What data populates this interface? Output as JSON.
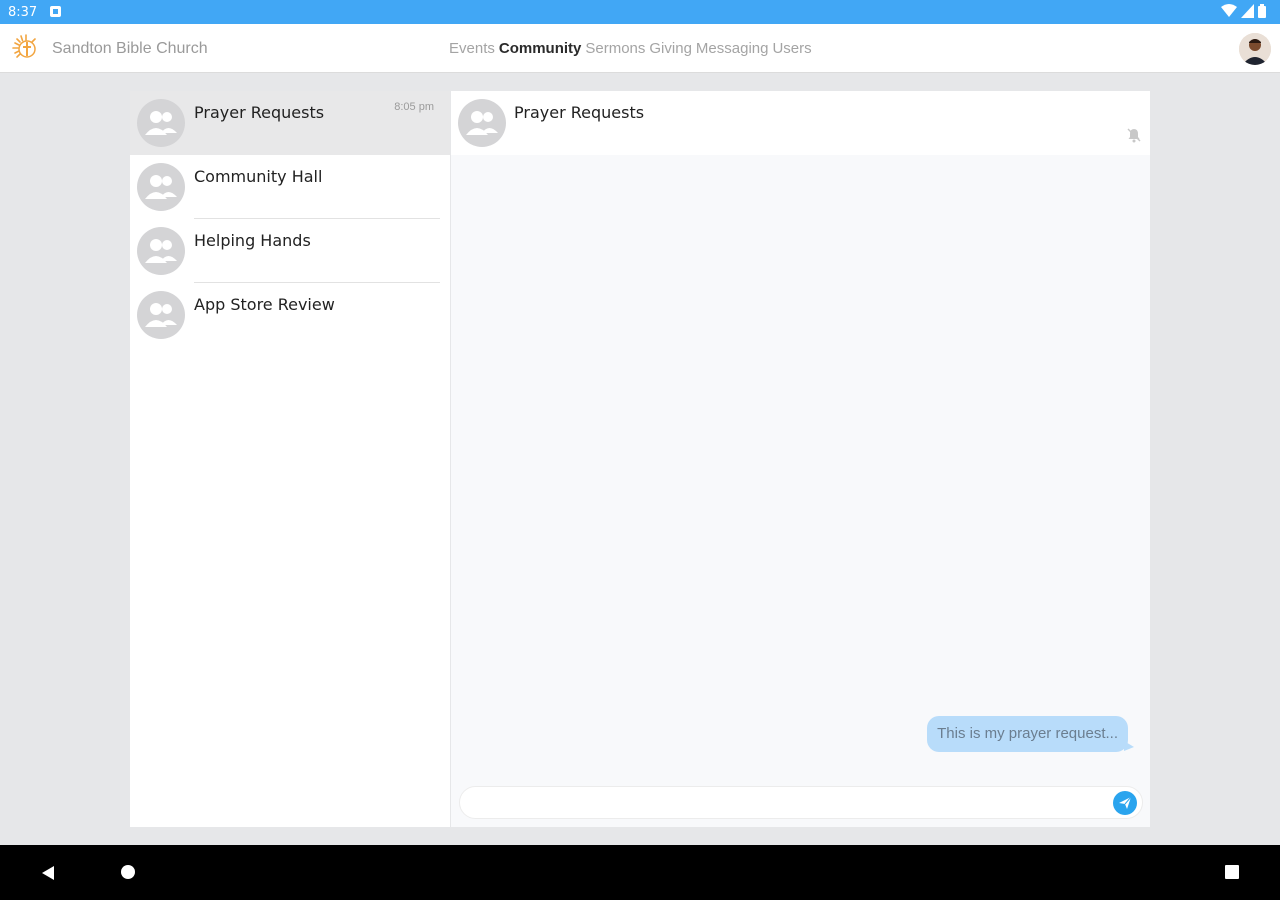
{
  "status_bar": {
    "time": "8:37"
  },
  "app": {
    "brand": "Sandton Bible Church",
    "nav": [
      {
        "label": "Events",
        "active": false
      },
      {
        "label": "Community",
        "active": true
      },
      {
        "label": "Sermons",
        "active": false
      },
      {
        "label": "Giving",
        "active": false
      },
      {
        "label": "Messaging",
        "active": false
      },
      {
        "label": "Users",
        "active": false
      }
    ]
  },
  "conversations": [
    {
      "name": "Prayer Requests",
      "time": "8:05 pm",
      "active": true
    },
    {
      "name": "Community Hall",
      "time": "",
      "active": false
    },
    {
      "name": "Helping Hands",
      "time": "",
      "active": false
    },
    {
      "name": "App Store Review",
      "time": "",
      "active": false
    }
  ],
  "chat": {
    "title": "Prayer Requests",
    "messages": [
      {
        "text": "This is my prayer request...",
        "outgoing": true
      }
    ],
    "composer_value": ""
  },
  "icons": {
    "group": "group-avatar-icon",
    "mute": "bell-off-icon",
    "send": "send-icon"
  },
  "colors": {
    "status_bar": "#41a7f5",
    "accent": "#2aa4ee",
    "bubble": "#b8dcfa"
  }
}
